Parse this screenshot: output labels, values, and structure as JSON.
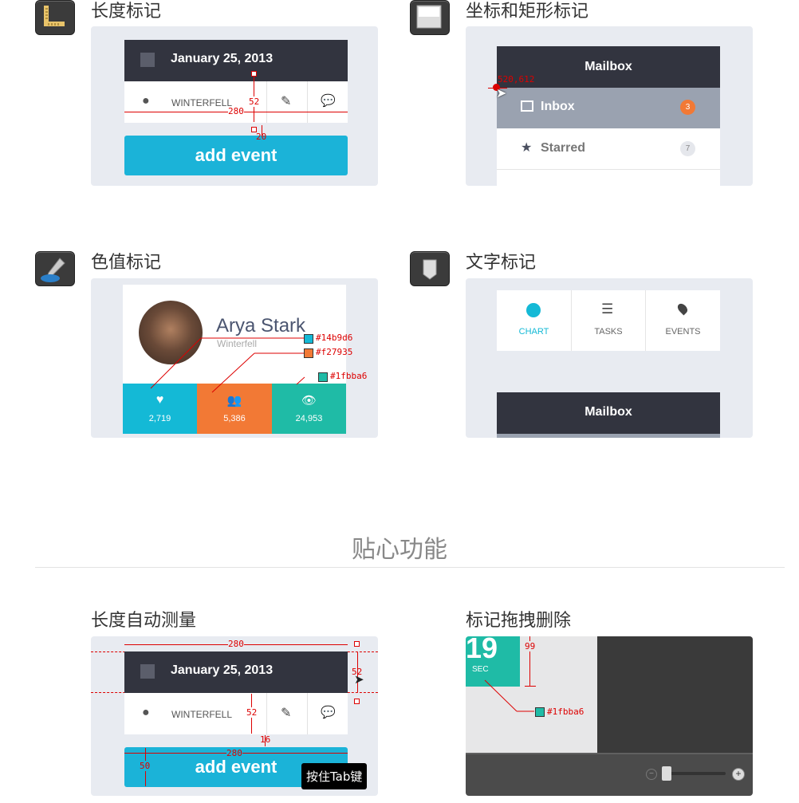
{
  "sections": {
    "length_mark": "长度标记",
    "coord_mark": "坐标和矩形标记",
    "color_mark": "色值标记",
    "text_mark": "文字标记",
    "features_heading": "贴心功能",
    "auto_measure": "长度自动测量",
    "drag_delete": "标记拖拽删除"
  },
  "event_card": {
    "date": "January 25, 2013",
    "location": "WINTERFELL",
    "button": "add event"
  },
  "length_marks": {
    "w280": "280",
    "h52": "52",
    "h20": "20"
  },
  "mailbox": {
    "title": "Mailbox",
    "coord": "520,612",
    "items": [
      {
        "label": "Inbox",
        "count": "3"
      },
      {
        "label": "Starred",
        "count": "7"
      }
    ]
  },
  "profile": {
    "name": "Arya Stark",
    "place": "Winterfell",
    "stats": [
      {
        "value": "2,719",
        "color": "#14b9d6"
      },
      {
        "value": "5,386",
        "color": "#f27935"
      },
      {
        "value": "24,953",
        "color": "#1fbba6"
      }
    ],
    "color_labels": [
      "#14b9d6",
      "#f27935",
      "#1fbba6"
    ]
  },
  "tabs": [
    {
      "label": "CHART",
      "icon": "pie-chart-icon"
    },
    {
      "label": "TASKS",
      "icon": "list-icon"
    },
    {
      "label": "EVENTS",
      "icon": "pin-icon"
    }
  ],
  "mailbox2": {
    "title": "Mailbox"
  },
  "auto_marks": {
    "w280": "280",
    "h52": "52",
    "h52b": "52",
    "h16": "16",
    "w280b": "280",
    "h50": "50"
  },
  "tooltip": "按住Tab键",
  "drag": {
    "big": "19",
    "sec": "SEC",
    "h99": "99",
    "color": "#1fbba6"
  }
}
